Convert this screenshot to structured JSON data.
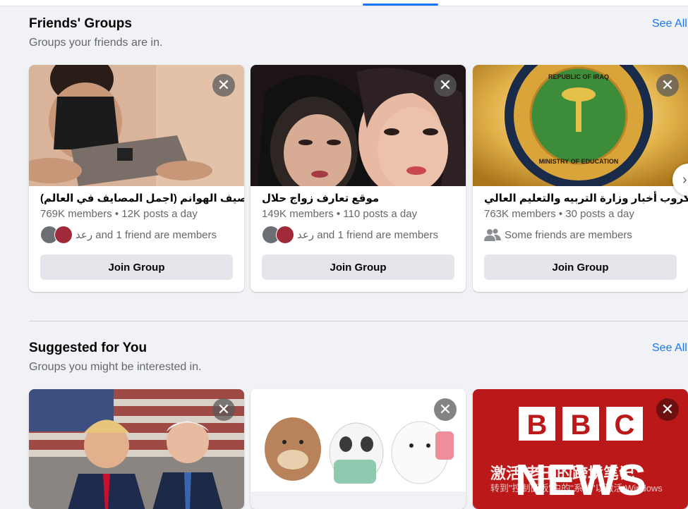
{
  "friends_section": {
    "title": "Friends' Groups",
    "subtitle": "Groups your friends are in.",
    "see_all": "See All"
  },
  "friends_groups": [
    {
      "name": "مصيف الهوانم (اجمل المصايف في العالم)",
      "meta": "769K members • 12K posts a day",
      "friends": "رعد and 1 friend are members",
      "join": "Join Group"
    },
    {
      "name": "موقع تعارف زواج حلال",
      "meta": "149K members • 110 posts a day",
      "friends": "رعد and 1 friend are members",
      "join": "Join Group"
    },
    {
      "name": "كروب أخبار وزارة التربيه والتعليم العالي",
      "meta": "763K members • 30 posts a day",
      "friends": "Some friends are members",
      "join": "Join Group"
    }
  ],
  "suggested_section": {
    "title": "Suggested for You",
    "subtitle": "Groups you might be interested in.",
    "see_all": "See All"
  },
  "suggested_cover_text": {
    "seal_top": "REPUBLIC OF IRAQ",
    "seal_bottom": "MINISTRY OF EDUCATION",
    "bbc": [
      "B",
      "B",
      "C"
    ],
    "news": "NEWS"
  },
  "watermark": {
    "line1": "激活 老王的跨境笔记",
    "line2": "转到\"控制面板\"中的\"系统\"以激活 Windows"
  },
  "icons": {
    "close": "close-icon",
    "next": "chevron-right-icon",
    "people": "people-icon"
  }
}
